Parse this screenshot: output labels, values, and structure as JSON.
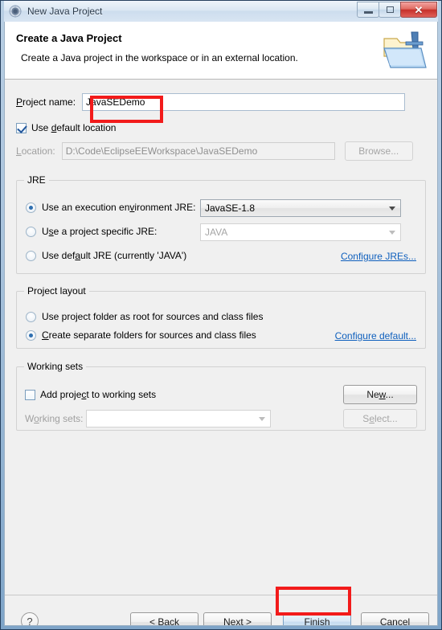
{
  "window": {
    "title": "New Java Project",
    "icon": "eclipse-icon",
    "controls": {
      "minimize": "minimize-icon",
      "restore": "restore-icon",
      "close": "close-icon",
      "close_glyph": "✕"
    }
  },
  "header": {
    "title": "Create a Java Project",
    "description": "Create a Java project in the workspace or in an external location.",
    "icon": "java-project-folder-icon"
  },
  "project": {
    "name_label": "Project name:",
    "name_label_parts": {
      "pre": "",
      "mnemonic": "P",
      "post": "roject name:"
    },
    "name_value": "JavaSEDemo",
    "name_placeholder": "",
    "use_default_location_label": "Use default location",
    "use_default_location_checked": true,
    "location_label": "Location:",
    "location_value": "D:\\Code\\EclipseEEWorkspace\\JavaSEDemo",
    "location_enabled": false,
    "browse_label": "Browse...",
    "browse_enabled": false
  },
  "jre": {
    "group_title": "JRE",
    "options": [
      {
        "label": "Use an execution environment JRE:",
        "selected": true
      },
      {
        "label": "Use a project specific JRE:",
        "selected": false
      },
      {
        "label": "Use default JRE (currently 'JAVA')",
        "selected": false
      }
    ],
    "execution_env_value": "JavaSE-1.8",
    "project_jre_value": "JAVA",
    "configure_link": "Configure JREs..."
  },
  "layout": {
    "group_title": "Project layout",
    "options": [
      {
        "label": "Use project folder as root for sources and class files",
        "selected": false
      },
      {
        "label": "Create separate folders for sources and class files",
        "selected": true
      }
    ],
    "configure_link": "Configure default..."
  },
  "working_sets": {
    "group_title": "Working sets",
    "add_label": "Add project to working sets",
    "add_checked": false,
    "new_label": "New...",
    "sets_label": "Working sets:",
    "sets_value": "",
    "select_label": "Select...",
    "select_enabled": false
  },
  "buttons": {
    "help": "?",
    "back": "< Back",
    "next": "Next >",
    "finish": "Finish",
    "cancel": "Cancel",
    "default_button": "finish"
  },
  "annotations": {
    "color": "#f21b1b",
    "boxes": [
      "project-name-value",
      "finish-button"
    ]
  }
}
